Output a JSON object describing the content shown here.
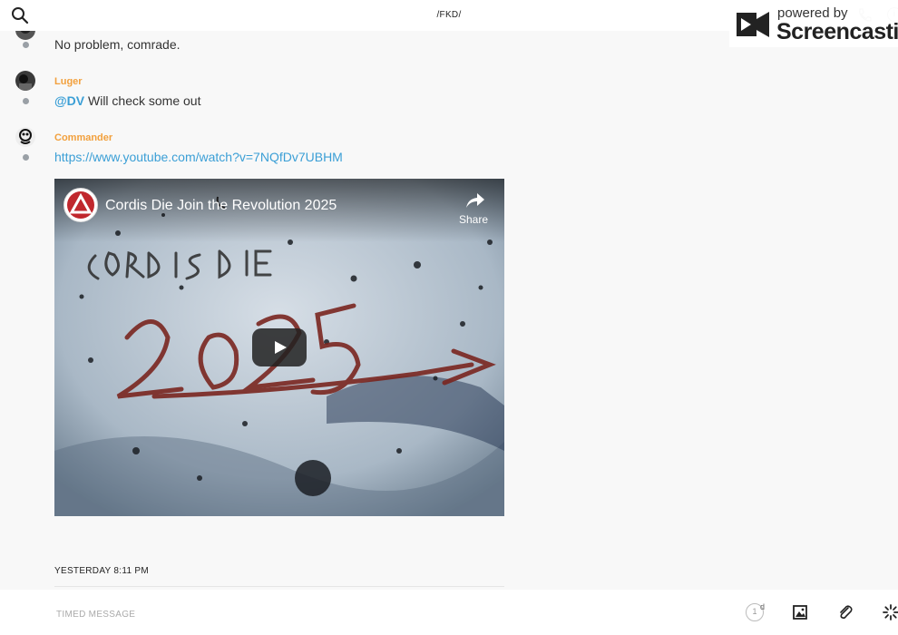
{
  "header": {
    "channel_title": "/FKD/",
    "icons": [
      "search-icon",
      "phone-icon",
      "info-icon"
    ]
  },
  "watermark": {
    "powered": "powered by",
    "brand": "Screencastify"
  },
  "messages": [
    {
      "author": "",
      "text": "No problem, comrade."
    },
    {
      "author": "Luger",
      "mention": "@DV",
      "text": " Will check some out"
    },
    {
      "author": "Commander",
      "link": "https://www.youtube.com/watch?v=7NQfDv7UBHM"
    }
  ],
  "video": {
    "title": "Cordis Die Join the Revolution 2025",
    "share_label": "Share"
  },
  "timestamp": "YESTERDAY 8:11 PM",
  "composer": {
    "placeholder": "TIMED MESSAGE",
    "timer_value": "1",
    "timer_unit": "d",
    "icons": [
      "image-icon",
      "paperclip-icon",
      "spinner-icon"
    ]
  },
  "colors": {
    "author": "#f2a03d",
    "link": "#3b9fd6"
  }
}
